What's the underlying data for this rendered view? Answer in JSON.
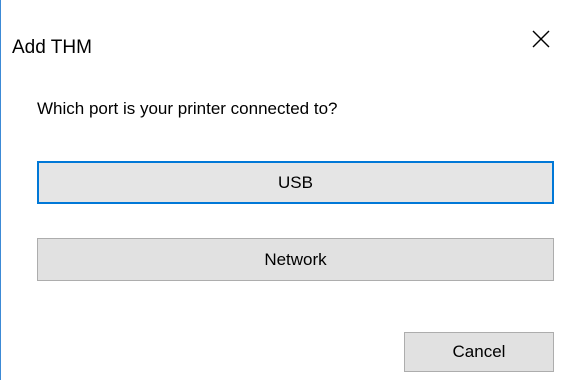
{
  "window": {
    "title": "Add THM",
    "close_icon": "close-icon"
  },
  "content": {
    "prompt": "Which port is your printer connected to?"
  },
  "buttons": {
    "usb_label": "USB",
    "network_label": "Network",
    "cancel_label": "Cancel"
  },
  "colors": {
    "focus_border": "#0078d7",
    "window_border": "#3c8ad6",
    "button_bg": "#e1e1e1"
  }
}
